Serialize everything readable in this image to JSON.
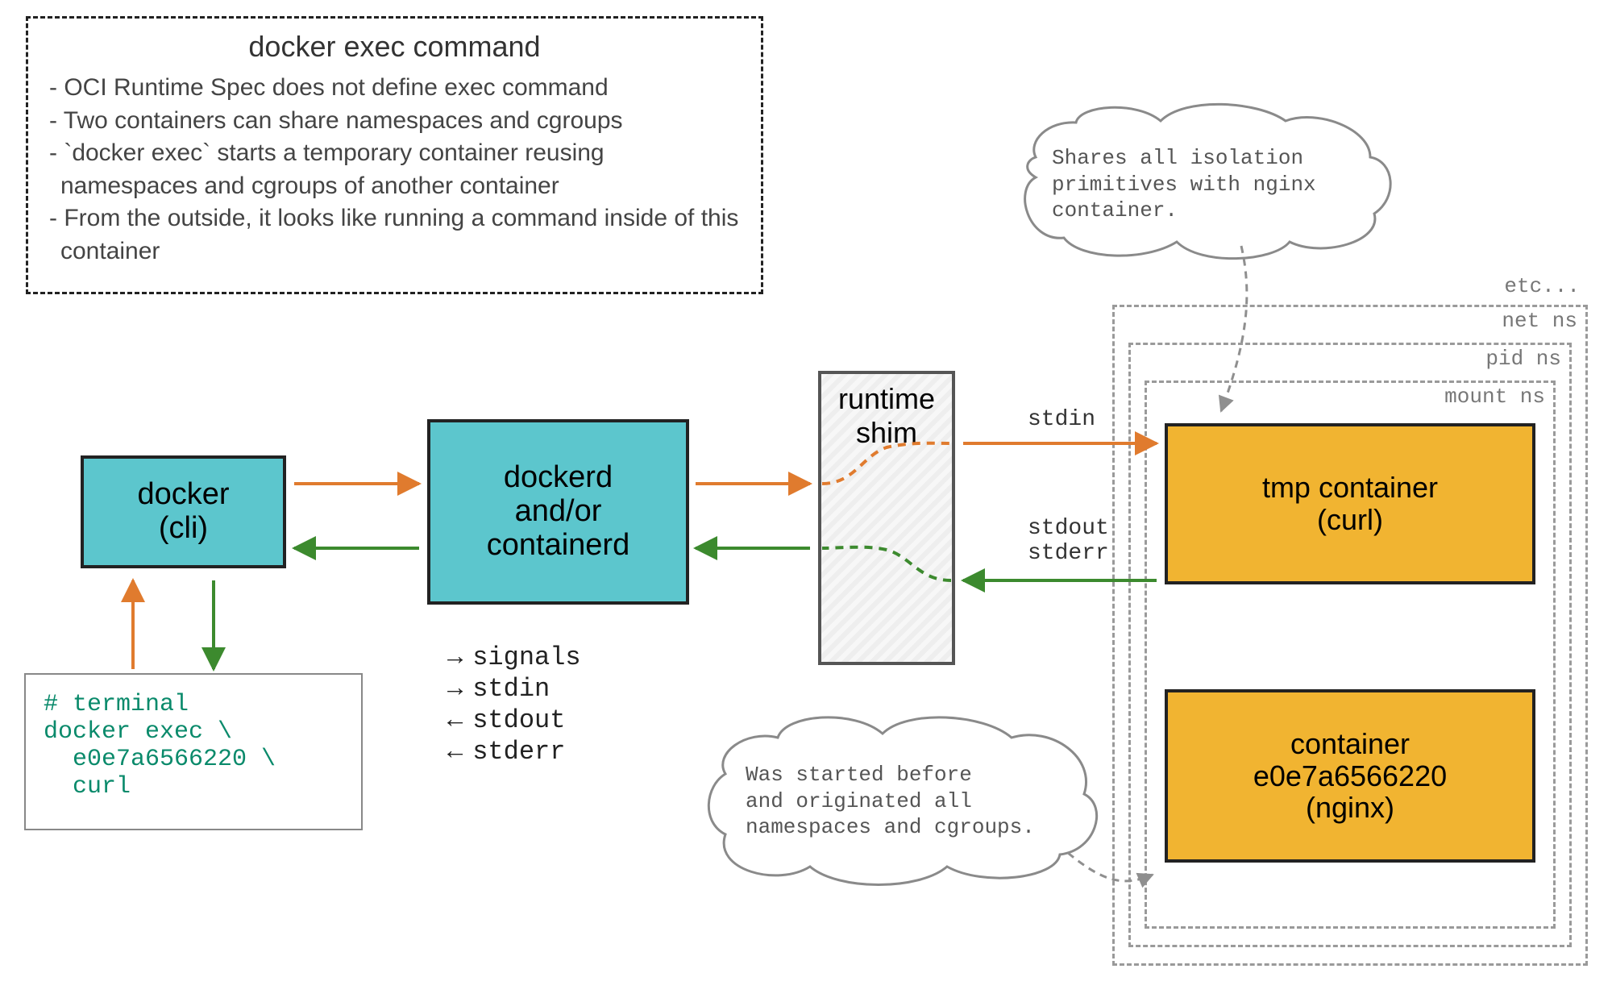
{
  "info": {
    "title": "docker exec command",
    "bullets": [
      "- OCI Runtime Spec does not define exec command",
      "- Two containers can share namespaces and cgroups",
      "- `docker exec` starts a temporary container reusing namespaces and cgroups of another container",
      "- From the outside, it looks like running a command inside of this container"
    ]
  },
  "boxes": {
    "cli": "docker\n(cli)",
    "dockerd": "dockerd\nand/or\ncontainerd",
    "shim": "runtime\nshim",
    "tmp_container": "tmp container\n(curl)",
    "nginx_container": "container\ne0e7a6566220\n(nginx)"
  },
  "terminal": "# terminal\ndocker exec \\\n  e0e7a6566220 \\\n  curl",
  "streams": [
    "signals",
    "stdin",
    "stdout",
    "stderr"
  ],
  "stream_arrows": [
    "→",
    "→",
    "←",
    "←"
  ],
  "shim_labels": {
    "stdin": "stdin",
    "stdout": "stdout\nstderr"
  },
  "ns": {
    "etc": "etc...",
    "net": "net ns",
    "pid": "pid ns",
    "mount": "mount ns"
  },
  "clouds": {
    "top": "Shares all isolation\nprimitives with nginx\ncontainer.",
    "bottom": "Was started before\nand originated all\nnamespaces and cgroups."
  },
  "colors": {
    "orange": "#e07b2e",
    "green": "#3c8a2e",
    "grey": "#8f8f8f"
  }
}
